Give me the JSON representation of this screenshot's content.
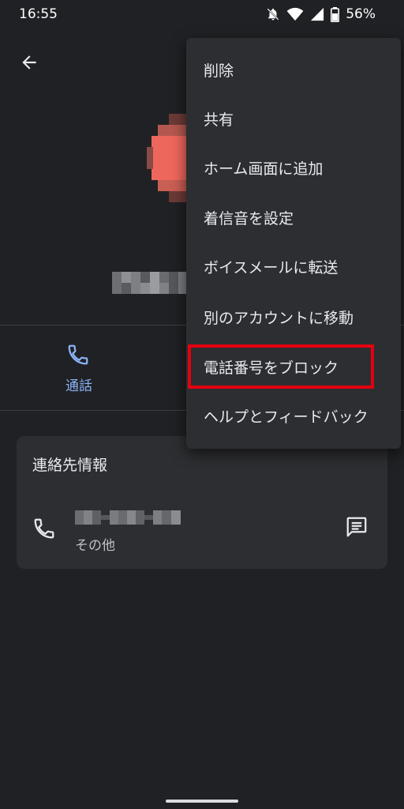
{
  "status_bar": {
    "time": "16:55",
    "battery_percent": "56%",
    "icons": [
      "notifications-off-icon",
      "wifi-icon",
      "cell-signal-icon",
      "battery-icon"
    ]
  },
  "header": {
    "back_icon": "arrow-back-icon"
  },
  "actions": {
    "call_label": "通話",
    "call_icon": "phone-icon"
  },
  "contact_info": {
    "title": "連絡先情報",
    "phone_type": "その他",
    "phone_icon": "phone-icon",
    "message_icon": "message-icon"
  },
  "menu": {
    "items": [
      {
        "label": "削除"
      },
      {
        "label": "共有"
      },
      {
        "label": "ホーム画面に追加"
      },
      {
        "label": "着信音を設定"
      },
      {
        "label": "ボイスメールに転送"
      },
      {
        "label": "別のアカウントに移動"
      },
      {
        "label": "電話番号をブロック"
      },
      {
        "label": "ヘルプとフィードバック"
      }
    ],
    "highlighted_index": 6
  },
  "colors": {
    "background": "#202124",
    "surface": "#2d2e31",
    "accent": "#8ab4f8",
    "highlight": "#e3000f",
    "avatar": "#ee675c"
  }
}
